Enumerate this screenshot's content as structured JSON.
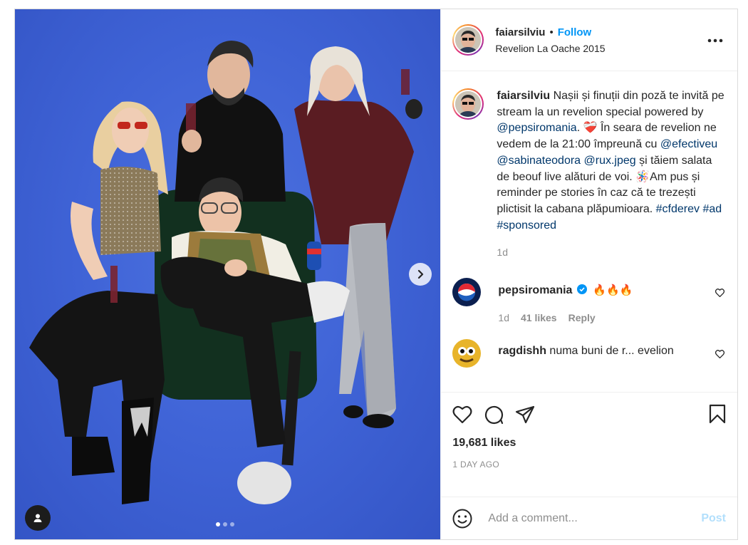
{
  "post": {
    "username": "faiarsilviu",
    "bullet": "•",
    "follow_label": "Follow",
    "location": "Revelion La Oache 2015",
    "more_icon": "more-horizontal-icon"
  },
  "media": {
    "carousel_dots": 3,
    "active_dot": 0,
    "next_icon": "chevron-right-icon",
    "tag_icon": "user-tag-icon"
  },
  "caption": {
    "username": "faiarsilviu",
    "t1": "Nașii și finuții din poză te invită pe stream la un revelion special powered by ",
    "m1": "@pepsiromania",
    "t2": ". ❤️‍🩹 În seara de revelion ne vedem de la 21:00 împreună cu ",
    "m2": "@efectiveu",
    "m3": "@sabinateodora",
    "m4": "@rux.jpeg",
    "t3": " și tăiem salata de beouf live alături de voi. 🪅Am pus și reminder pe stories în caz că te trezești plictisit la cabana plăpumioara. ",
    "h1": "#cfderev",
    "h2": "#ad",
    "h3": "#sponsored",
    "time": "1d"
  },
  "comments": [
    {
      "username": "pepsiromania",
      "verified": true,
      "text": "🔥🔥🔥",
      "time": "1d",
      "likes": "41 likes",
      "reply": "Reply"
    },
    {
      "username": "ragdishh",
      "text": "numa buni de r... evelion"
    }
  ],
  "actions": {
    "likes": "19,681 likes",
    "date": "1 DAY AGO"
  },
  "comment_box": {
    "placeholder": "Add a comment...",
    "post_label": "Post",
    "emoji_icon": "smiley-icon"
  },
  "colors": {
    "accent": "#0095f6",
    "link": "#00376b",
    "muted": "#8e8e8e",
    "post_disabled": "#b2dffc",
    "photo_bg": "#3f63d6"
  }
}
